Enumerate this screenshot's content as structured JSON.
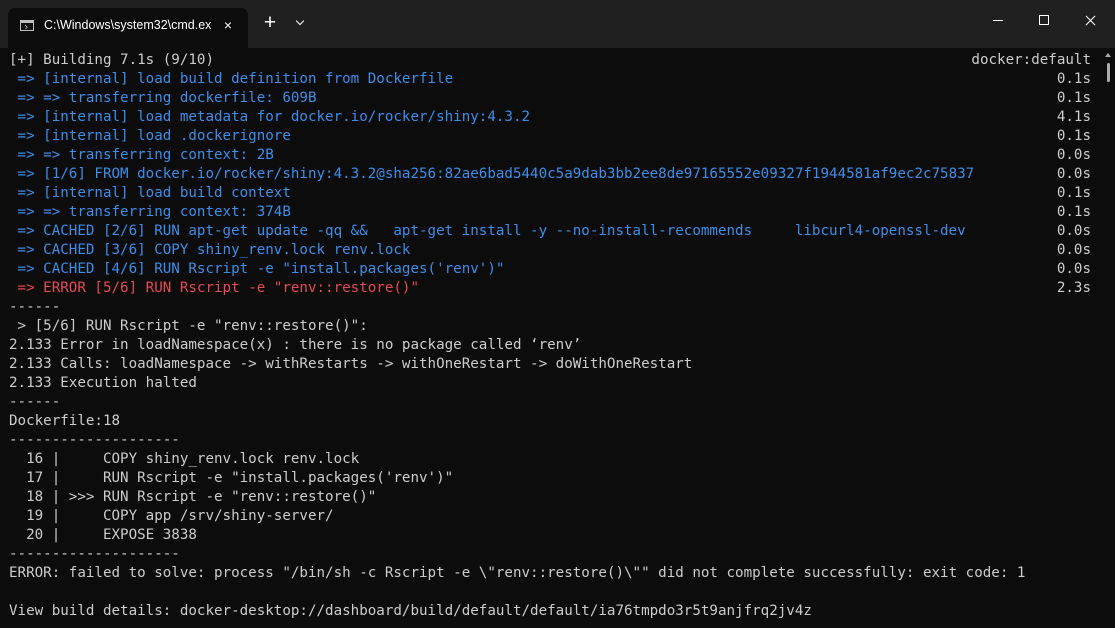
{
  "window": {
    "tab_title": "C:\\Windows\\system32\\cmd.exe",
    "tab_close": "×",
    "new_tab": "+"
  },
  "terminal": {
    "header": "[+] Building 7.1s (9/10)",
    "context": "docker:default",
    "steps": [
      {
        "text": " => [internal] load build definition from Dockerfile",
        "time": "0.1s",
        "status": "info"
      },
      {
        "text": " => => transferring dockerfile: 609B",
        "time": "0.1s",
        "status": "info"
      },
      {
        "text": " => [internal] load metadata for docker.io/rocker/shiny:4.3.2",
        "time": "4.1s",
        "status": "info"
      },
      {
        "text": " => [internal] load .dockerignore",
        "time": "0.1s",
        "status": "info"
      },
      {
        "text": " => => transferring context: 2B",
        "time": "0.0s",
        "status": "info"
      },
      {
        "text": " => [1/6] FROM docker.io/rocker/shiny:4.3.2@sha256:82ae6bad5440c5a9dab3bb2ee8de97165552e09327f1944581af9ec2c75837",
        "time": "0.0s",
        "status": "info"
      },
      {
        "text": " => [internal] load build context",
        "time": "0.1s",
        "status": "info"
      },
      {
        "text": " => => transferring context: 374B",
        "time": "0.1s",
        "status": "info"
      },
      {
        "text": " => CACHED [2/6] RUN apt-get update -qq &&   apt-get install -y --no-install-recommends     libcurl4-openssl-dev",
        "time": "0.0s",
        "status": "info"
      },
      {
        "text": " => CACHED [3/6] COPY shiny_renv.lock renv.lock",
        "time": "0.0s",
        "status": "info"
      },
      {
        "text": " => CACHED [4/6] RUN Rscript -e \"install.packages('renv')\"",
        "time": "0.0s",
        "status": "info"
      },
      {
        "text": " => ERROR [5/6] RUN Rscript -e \"renv::restore()\"",
        "time": "2.3s",
        "status": "error"
      }
    ],
    "lines": [
      "------",
      " > [5/6] RUN Rscript -e \"renv::restore()\":",
      "2.133 Error in loadNamespace(x) : there is no package called ‘renv’",
      "2.133 Calls: loadNamespace -> withRestarts -> withOneRestart -> doWithOneRestart",
      "2.133 Execution halted",
      "------",
      "Dockerfile:18",
      "--------------------",
      "  16 |     COPY shiny_renv.lock renv.lock",
      "  17 |     RUN Rscript -e \"install.packages('renv')\"",
      "  18 | >>> RUN Rscript -e \"renv::restore()\"",
      "  19 |     COPY app /srv/shiny-server/",
      "  20 |     EXPOSE 3838",
      "--------------------",
      "ERROR: failed to solve: process \"/bin/sh -c Rscript -e \\\"renv::restore()\\\"\" did not complete successfully: exit code: 1",
      "",
      "View build details: docker-desktop://dashboard/build/default/default/ia76tmpdo3r5t9anjfrq2jv4z"
    ]
  },
  "colors": {
    "background": "#0c0c0c",
    "titlebar": "#202020",
    "text": "#cccccc",
    "info": "#3b8eea",
    "error": "#e74856"
  }
}
